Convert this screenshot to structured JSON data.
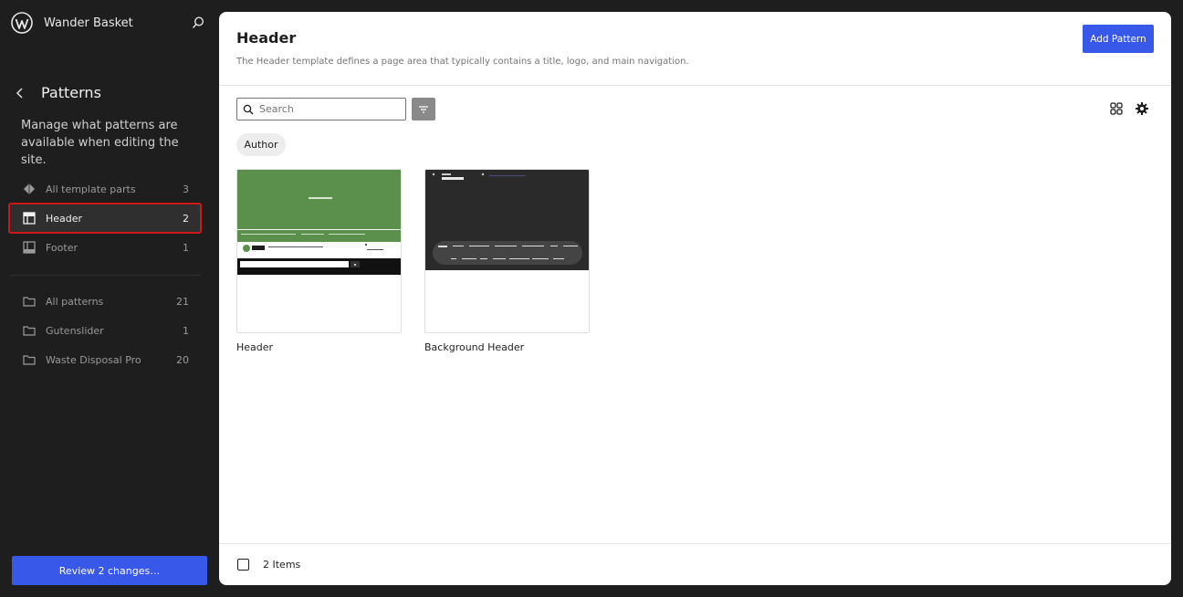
{
  "site": {
    "name": "Wander Basket"
  },
  "sidebar": {
    "title": "Patterns",
    "description": "Manage what patterns are available when editing the site.",
    "template_parts": [
      {
        "label": "All template parts",
        "count": "3",
        "icon": "diamond-icon"
      },
      {
        "label": "Header",
        "count": "2",
        "icon": "header-layout-icon",
        "active": true
      },
      {
        "label": "Footer",
        "count": "1",
        "icon": "footer-layout-icon"
      }
    ],
    "categories": [
      {
        "label": "All patterns",
        "count": "21",
        "icon": "folder-icon"
      },
      {
        "label": "Gutenslider",
        "count": "1",
        "icon": "folder-icon"
      },
      {
        "label": "Waste Disposal Pro",
        "count": "20",
        "icon": "folder-icon"
      }
    ],
    "review_button": "Review 2 changes…"
  },
  "main": {
    "title": "Header",
    "description": "The Header template defines a page area that typically contains a title, logo, and main navigation.",
    "add_button": "Add Pattern",
    "search_placeholder": "Search",
    "filter_chip": "Author",
    "cards": [
      {
        "title": "Header"
      },
      {
        "title": "Background Header"
      }
    ],
    "footer_count": "2 Items"
  },
  "colors": {
    "accent": "#3858e9",
    "sidebar_bg": "#1e1e1e",
    "active_outline": "#cc1818",
    "thumb_green": "#5a8f4c"
  }
}
